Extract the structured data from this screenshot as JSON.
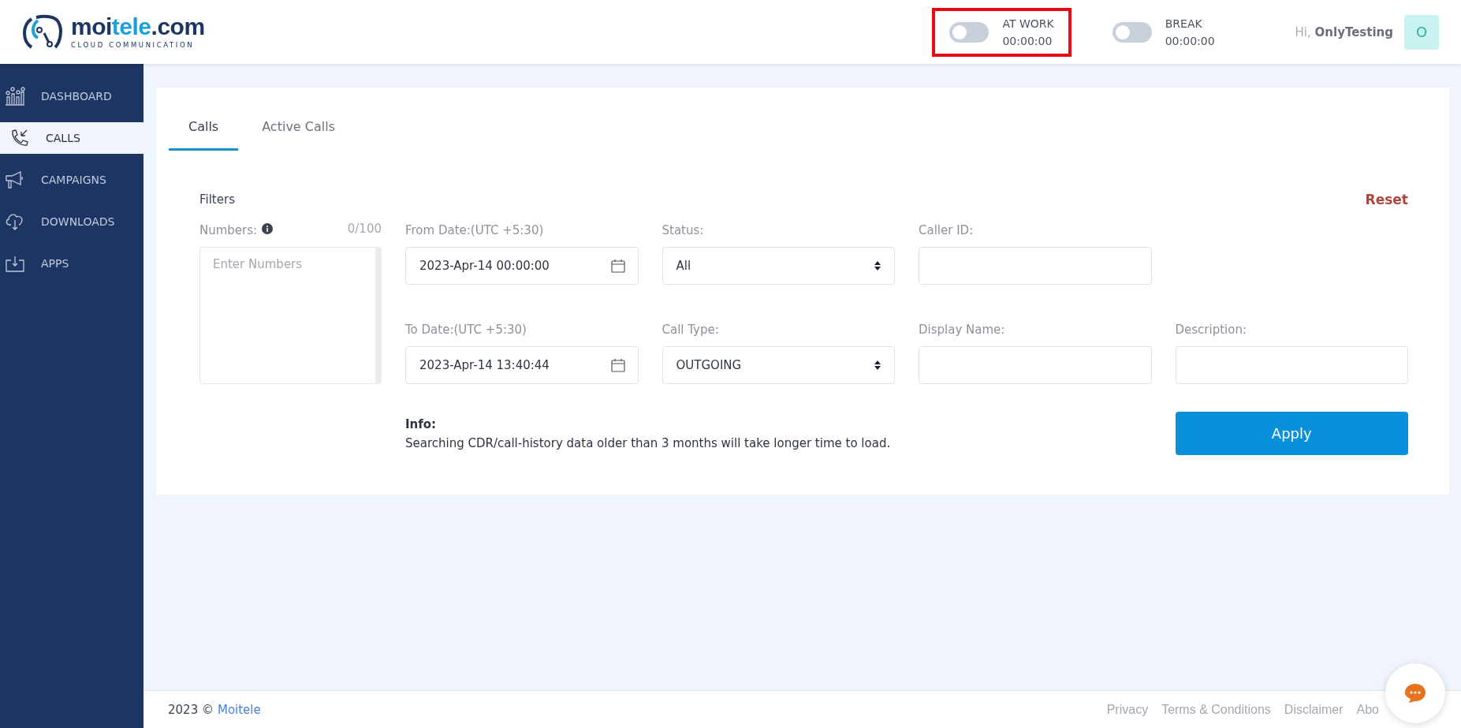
{
  "brand": {
    "name_dark": "moi",
    "name_light": "tele",
    "name_suffix": ".com",
    "tagline": "CLOUD COMMUNICATION"
  },
  "header": {
    "toggles": [
      {
        "label": "AT WORK",
        "time": "00:00:00",
        "on": false,
        "highlighted": true
      },
      {
        "label": "BREAK",
        "time": "00:00:00",
        "on": false,
        "highlighted": false
      }
    ],
    "greeting": "Hi,",
    "user": "OnlyTesting",
    "avatar": "O"
  },
  "sidebar": {
    "items": [
      {
        "label": "DASHBOARD",
        "kind": "chart",
        "selected": false
      },
      {
        "label": "CALLS",
        "kind": "phone",
        "selected": true
      },
      {
        "label": "CAMPAIGNS",
        "kind": "megaphone",
        "selected": false
      },
      {
        "label": "DOWNLOADS",
        "kind": "cloud",
        "selected": false
      },
      {
        "label": "APPS",
        "kind": "tray",
        "selected": false
      }
    ]
  },
  "tabs": [
    {
      "label": "Calls",
      "selected": true
    },
    {
      "label": "Active Calls",
      "selected": false
    }
  ],
  "filters": {
    "title": "Filters",
    "reset": "Reset",
    "numbers": {
      "label": "Numbers:",
      "count": "0/100",
      "placeholder": "Enter Numbers"
    },
    "from_date": {
      "label": "From Date:(UTC +5:30)",
      "value": "2023-Apr-14   00:00:00"
    },
    "status": {
      "label": "Status:",
      "value": "All"
    },
    "caller_id": {
      "label": "Caller ID:"
    },
    "to_date": {
      "label": "To Date:(UTC +5:30)",
      "value": "2023-Apr-14   13:40:44"
    },
    "call_type": {
      "label": "Call Type:",
      "value": "OUTGOING"
    },
    "display_name": {
      "label": "Display Name:"
    },
    "description": {
      "label": "Description:"
    },
    "info_title": "Info:",
    "info_text": "Searching CDR/call-history data older than 3 months will take longer time to load.",
    "apply": "Apply"
  },
  "footer": {
    "year": "2023 ©",
    "company": "Moitele",
    "links": [
      "Privacy",
      "Terms & Conditions",
      "Disclaimer",
      "Abo"
    ]
  }
}
